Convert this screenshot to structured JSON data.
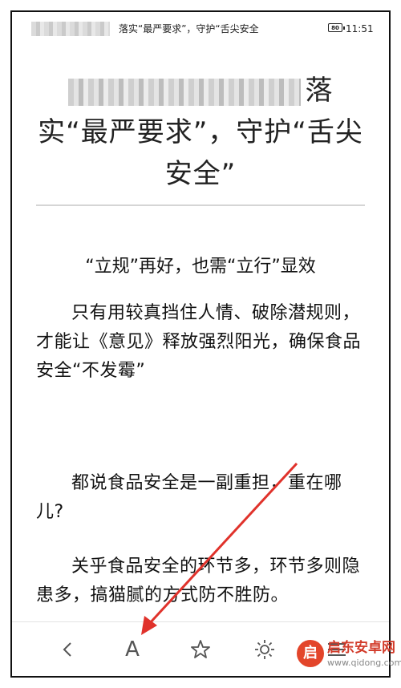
{
  "status_bar": {
    "title": "落实“最严要求”，守护“舌尖安全",
    "battery": "80",
    "time": "11:51"
  },
  "article": {
    "title_line1_suffix": "落",
    "title_line2": "实“最严要求”，守护“舌尖",
    "title_line3": "安全”",
    "subheading": "“立规”再好，也需“立行”显效",
    "paragraph1": "只有用较真挡住人情、破除潜规则，才能让《意见》释放强烈阳光，确保食品安全“不发霉”",
    "paragraph2": "都说食品安全是一副重担，重在哪儿?",
    "paragraph3": "关乎食品安全的环节多，环节多则隐患多，搞猫腻的方式防不胜防。"
  },
  "toolbar": {
    "back_icon": "chevron-left-icon",
    "font_label": "A",
    "star_icon": "star-icon",
    "brightness_icon": "sun-icon",
    "menu_icon": "menu-icon"
  },
  "annotation": {
    "arrow_color": "#e0322b"
  },
  "watermark": {
    "logo_char": "启",
    "name": "启东安卓网",
    "url": "www.qidong.com"
  }
}
